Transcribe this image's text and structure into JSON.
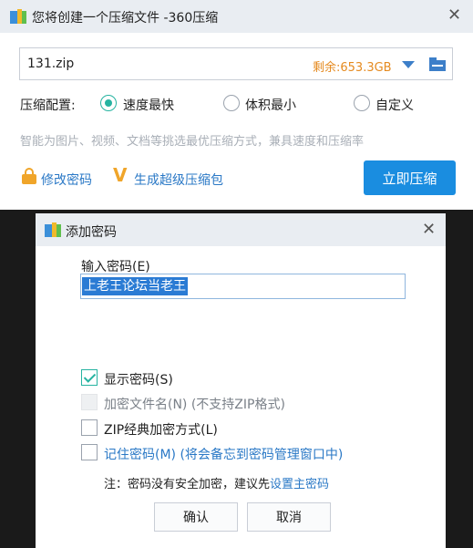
{
  "main_window": {
    "title": "您将创建一个压缩文件 -360压缩",
    "close_symbol": "✕",
    "file_name": "131.zip",
    "space_left": "剩余:653.3GB",
    "config_label": "压缩配置:",
    "options": [
      {
        "label": "速度最快",
        "selected": true
      },
      {
        "label": "体积最小",
        "selected": false
      },
      {
        "label": "自定义",
        "selected": false
      }
    ],
    "hint": "智能为图片、视频、文档等挑选最优压缩方式，兼具速度和压缩率",
    "change_password_label": "修改密码",
    "super_pack_label": "生成超级压缩包",
    "compress_button": "立即压缩"
  },
  "password_dialog": {
    "title": "添加密码",
    "close_symbol": "✕",
    "input_label": "输入密码(E)",
    "password_value": "上老王论坛当老王",
    "checkboxes": {
      "show_password": {
        "label": "显示密码(S)",
        "checked": true
      },
      "encrypt_filename": {
        "label": "加密文件名(N) (不支持ZIP格式)",
        "checked": false,
        "disabled": true
      },
      "zip_classic": {
        "label": "ZIP经典加密方式(L)",
        "checked": false
      },
      "remember_password": {
        "label": "记住密码(M) (将会备忘到密码管理窗口中)",
        "checked": false
      }
    },
    "note_text": "注：密码没有安全加密，建议先",
    "note_link": "设置主密码",
    "ok_button": "确认",
    "cancel_button": "取消"
  },
  "colors": {
    "accent_blue": "#1a8de0",
    "link_blue": "#2a78c6",
    "check_teal": "#26b3a1",
    "space_orange": "#e58a1f",
    "icon_gold": "#f0a52a"
  },
  "icons": [
    "app-logo-icon",
    "close-icon",
    "dropdown-arrow-icon",
    "folder-icon",
    "lock-icon",
    "super-pack-v-icon",
    "checkmark-icon"
  ]
}
